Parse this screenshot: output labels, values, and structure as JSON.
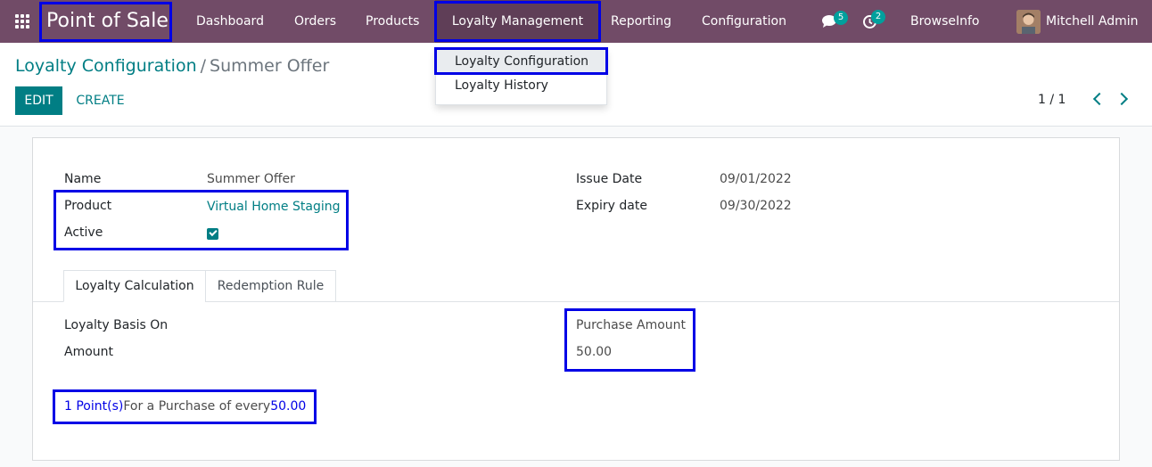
{
  "navbar": {
    "app_name": "Point of Sale",
    "menu": [
      "Dashboard",
      "Orders",
      "Products",
      "Loyalty Management",
      "Reporting",
      "Configuration"
    ],
    "messages_count": "5",
    "activities_count": "2",
    "company": "BrowseInfo",
    "user": "Mitchell Admin"
  },
  "dropdown": {
    "items": [
      "Loyalty Configuration",
      "Loyalty History"
    ]
  },
  "breadcrumb": {
    "parent": "Loyalty Configuration",
    "separator": "/",
    "current": "Summer Offer"
  },
  "toolbar": {
    "edit_label": "EDIT",
    "create_label": "CREATE"
  },
  "pager": {
    "value": "1 / 1"
  },
  "form": {
    "name_label": "Name",
    "name_value": "Summer Offer",
    "product_label": "Product",
    "product_value": "Virtual Home Staging",
    "active_label": "Active",
    "issue_date_label": "Issue Date",
    "issue_date_value": "09/01/2022",
    "expiry_date_label": "Expiry date",
    "expiry_date_value": "09/30/2022"
  },
  "tabs": [
    "Loyalty Calculation",
    "Redemption Rule"
  ],
  "calc": {
    "basis_label": "Loyalty Basis On",
    "basis_value": "Purchase Amount",
    "amount_label": "Amount",
    "amount_value": "50.00",
    "rule_points": "1 Point(s)",
    "rule_text": "For a Purchase of every",
    "rule_amount": "50.00"
  },
  "colors": {
    "navbar": "#714b67",
    "accent": "#017e84",
    "badge": "#00a09d",
    "annotation": "#0000e6"
  },
  "icons": [
    "apps-grid-icon",
    "chat-icon",
    "clock-icon",
    "chevron-left-icon",
    "chevron-right-icon",
    "checkbox-checked-icon"
  ]
}
